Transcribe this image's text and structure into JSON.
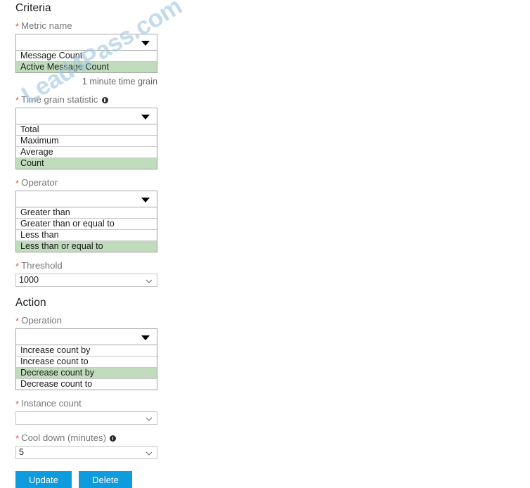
{
  "criteria": {
    "heading": "Criteria",
    "metric_name": {
      "label": "Metric name",
      "required_marker": "*",
      "value": "",
      "options": [
        "Message Count",
        "Active Message Count"
      ],
      "selected": "Active Message Count",
      "caret_icon": "caret-down-icon",
      "helper_text": "1 minute time grain"
    },
    "time_grain_statistic": {
      "label": "Time grain statistic",
      "required_marker": "*",
      "info_icon": "info-icon",
      "value": "",
      "options": [
        "Total",
        "Maximum",
        "Average",
        "Count"
      ],
      "selected": "Count",
      "caret_icon": "caret-down-icon"
    },
    "operator": {
      "label": "Operator",
      "required_marker": "*",
      "value": "",
      "options": [
        "Greater than",
        "Greater than or equal to",
        "Less than",
        "Less than or equal to"
      ],
      "selected": "Less than or equal to",
      "caret_icon": "caret-down-icon"
    },
    "threshold": {
      "label": "Threshold",
      "required_marker": "*",
      "value": "1000",
      "chevron_icon": "chevron-down-icon"
    }
  },
  "action": {
    "heading": "Action",
    "operation": {
      "label": "Operation",
      "required_marker": "*",
      "value": "",
      "options": [
        "Increase count by",
        "Increase count to",
        "Decrease count by",
        "Decrease count to"
      ],
      "selected": "Decrease count by",
      "caret_icon": "caret-down-icon"
    },
    "instance_count": {
      "label": "Instance count",
      "required_marker": "*",
      "value": "",
      "chevron_icon": "chevron-down-icon"
    },
    "cool_down": {
      "label": "Cool down (minutes)",
      "required_marker": "*",
      "info_icon": "info-icon",
      "value": "5",
      "chevron_icon": "chevron-down-icon"
    }
  },
  "buttons": {
    "update": "Update",
    "delete": "Delete"
  },
  "watermark": {
    "text": "Lead4Pass.com"
  },
  "colors": {
    "accent_button": "#0e9cdf",
    "selected_option": "#c0dcbd",
    "required_asterisk": "#e25c4b",
    "label_text": "#767676",
    "watermark": "#9fc6e0"
  }
}
